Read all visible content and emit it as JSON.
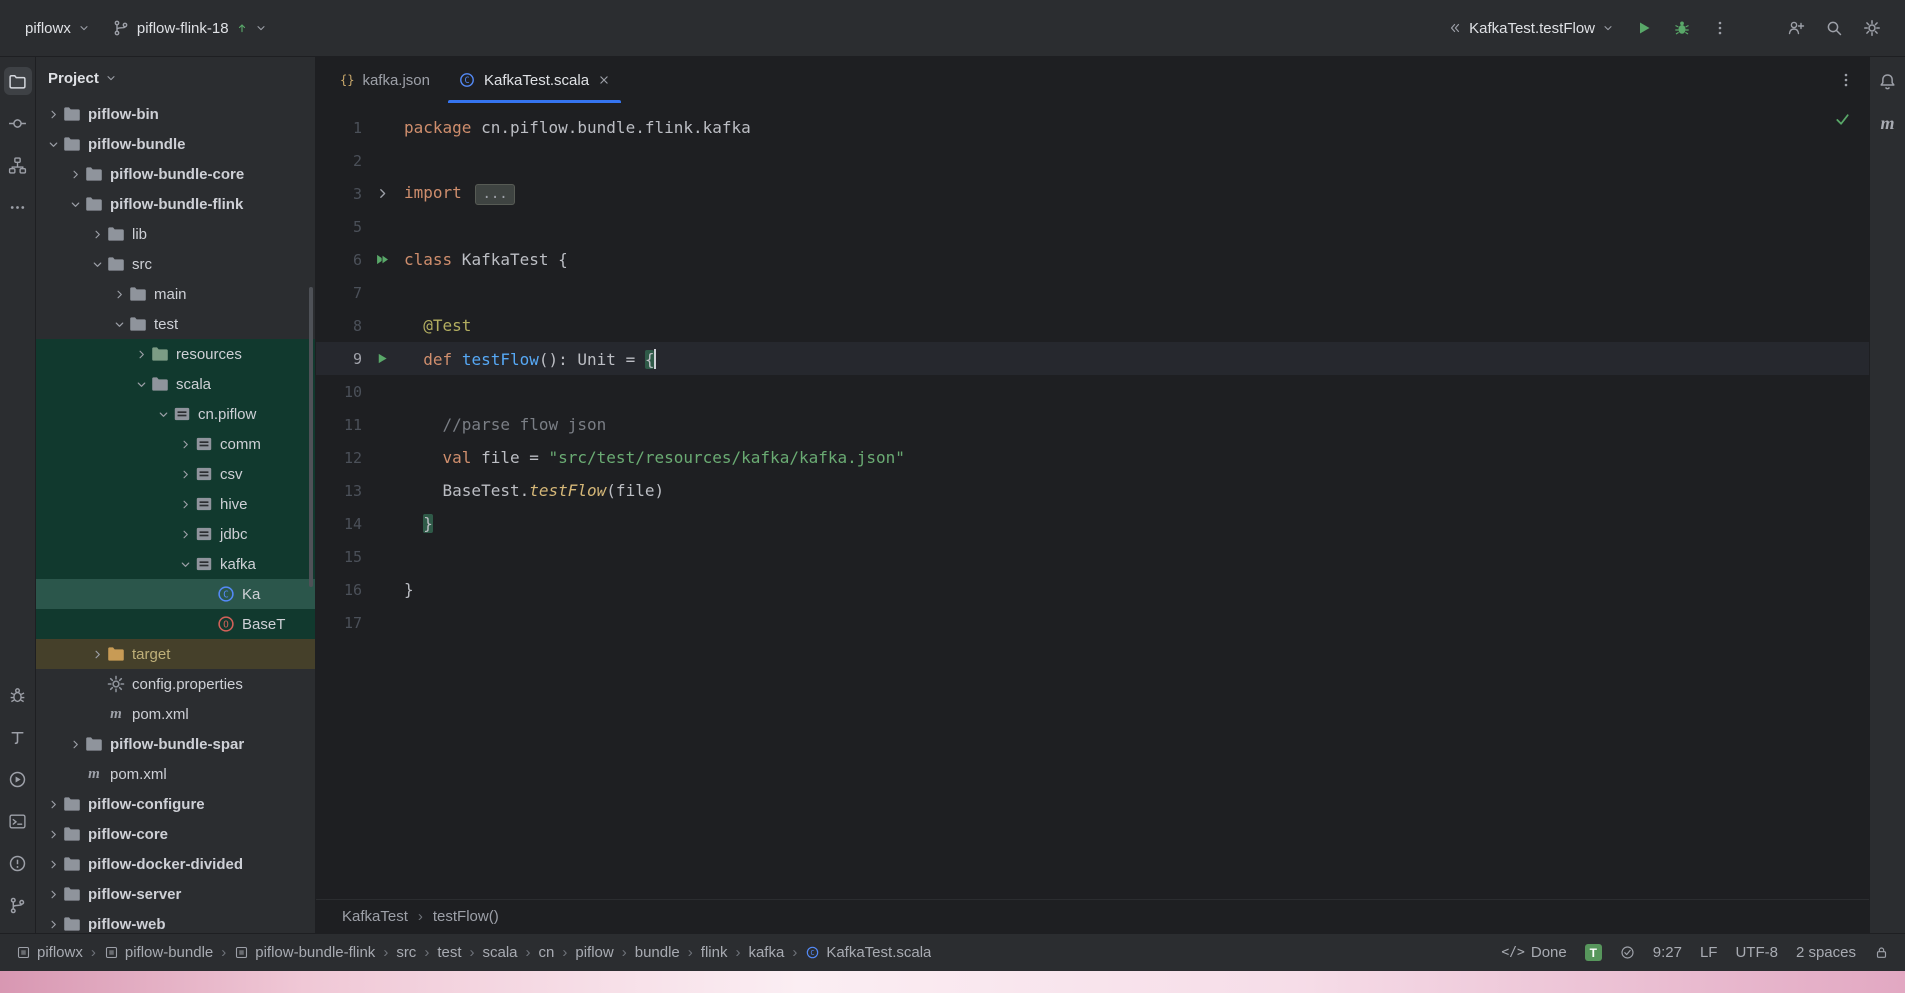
{
  "colors": {
    "panel_bg": "#2B2D30",
    "editor_bg": "#1E1F22",
    "accent_blue": "#3574F0",
    "run_green": "#59A869",
    "tree_test_bg": "#11392E",
    "tree_selected_bg": "#2B564B",
    "tree_excluded_bg": "#45402A",
    "keyword": "#CF8E6D",
    "string": "#6AAB73",
    "comment": "#7A7E85",
    "annotation": "#B3AE60",
    "function_decl": "#56A8F5",
    "method_call": "#D5B778"
  },
  "titlebar": {
    "project_name": "piflowx",
    "branch_name": "piflow-flink-18",
    "run_config": "KafkaTest.testFlow"
  },
  "left_stripe": {
    "top": [
      {
        "name": "project-icon"
      },
      {
        "name": "commit-icon"
      },
      {
        "name": "structure-icon"
      },
      {
        "name": "more-tools-icon"
      }
    ],
    "bottom": [
      {
        "name": "debug-icon"
      },
      {
        "name": "build-icon"
      },
      {
        "name": "run-icon"
      },
      {
        "name": "terminal-icon"
      },
      {
        "name": "problems-icon"
      },
      {
        "name": "version-control-icon"
      }
    ]
  },
  "right_stripe": [
    {
      "name": "notifications-bell-icon"
    },
    {
      "name": "maven-tool-icon"
    }
  ],
  "project_panel": {
    "title": "Project",
    "tree": [
      {
        "label": "piflow-bin",
        "level": 1,
        "icon": "folder",
        "chevron": "closed",
        "bold": true
      },
      {
        "label": "piflow-bundle",
        "level": 1,
        "icon": "folder",
        "chevron": "open",
        "bold": true
      },
      {
        "label": "piflow-bundle-core",
        "level": 2,
        "icon": "folder",
        "chevron": "closed",
        "bold": true
      },
      {
        "label": "piflow-bundle-flink",
        "level": 2,
        "icon": "folder",
        "chevron": "open",
        "bold": true
      },
      {
        "label": "lib",
        "level": 3,
        "icon": "folder",
        "chevron": "closed"
      },
      {
        "label": "src",
        "level": 3,
        "icon": "folder",
        "chevron": "open"
      },
      {
        "label": "main",
        "level": 4,
        "icon": "folder",
        "chevron": "closed"
      },
      {
        "label": "test",
        "level": 4,
        "icon": "folder",
        "chevron": "open"
      },
      {
        "label": "resources",
        "level": 5,
        "icon": "folder-resources",
        "chevron": "closed",
        "bg": "green"
      },
      {
        "label": "scala",
        "level": 5,
        "icon": "folder",
        "chevron": "open",
        "bg": "green"
      },
      {
        "label": "cn.piflow",
        "level": 6,
        "icon": "package",
        "chevron": "open",
        "bg": "green"
      },
      {
        "label": "comm",
        "level": 7,
        "icon": "package",
        "chevron": "closed",
        "bg": "green"
      },
      {
        "label": "csv",
        "level": 7,
        "icon": "package",
        "chevron": "closed",
        "bg": "green"
      },
      {
        "label": "hive",
        "level": 7,
        "icon": "package",
        "chevron": "closed",
        "bg": "green"
      },
      {
        "label": "jdbc",
        "level": 7,
        "icon": "package",
        "chevron": "closed",
        "bg": "green"
      },
      {
        "label": "kafka",
        "level": 7,
        "icon": "package",
        "chevron": "open",
        "bg": "green"
      },
      {
        "label": "Ka",
        "level": 8,
        "icon": "scala-class",
        "chevron": null,
        "bg": "sel"
      },
      {
        "label": "BaseT",
        "level": 8,
        "icon": "scala-object",
        "chevron": null,
        "bg": "green"
      },
      {
        "label": "target",
        "level": 3,
        "icon": "folder-excluded",
        "chevron": "closed",
        "bg": "olive"
      },
      {
        "label": "config.properties",
        "level": 3,
        "icon": "properties",
        "chevron": null
      },
      {
        "label": "pom.xml",
        "level": 3,
        "icon": "maven-file",
        "chevron": null
      },
      {
        "label": "piflow-bundle-spar",
        "level": 2,
        "icon": "folder",
        "chevron": "closed",
        "bold": true
      },
      {
        "label": "pom.xml",
        "level": 2,
        "icon": "maven-file",
        "chevron": null
      },
      {
        "label": "piflow-configure",
        "level": 1,
        "icon": "folder",
        "chevron": "closed",
        "bold": true
      },
      {
        "label": "piflow-core",
        "level": 1,
        "icon": "folder",
        "chevron": "closed",
        "bold": true
      },
      {
        "label": "piflow-docker-divided",
        "level": 1,
        "icon": "folder",
        "chevron": "closed",
        "bold": true
      },
      {
        "label": "piflow-server",
        "level": 1,
        "icon": "folder",
        "chevron": "closed",
        "bold": true
      },
      {
        "label": "piflow-web",
        "level": 1,
        "icon": "folder",
        "chevron": "closed",
        "bold": true
      }
    ]
  },
  "editor": {
    "tabs": [
      {
        "label": "kafka.json",
        "icon": "json-file",
        "active": false
      },
      {
        "label": "KafkaTest.scala",
        "icon": "scala-class",
        "active": true,
        "closable": true
      }
    ],
    "lines": [
      {
        "n": "1",
        "seg": [
          [
            "package",
            "kw"
          ],
          [
            " cn.piflow.bundle.flink.kafka",
            "pl"
          ]
        ]
      },
      {
        "n": "2",
        "seg": []
      },
      {
        "n": "3",
        "seg": [
          [
            "import",
            "kw"
          ],
          [
            " ",
            "pl"
          ]
        ],
        "fold": "...",
        "gutter": "fold"
      },
      {
        "n": "5",
        "seg": []
      },
      {
        "n": "6",
        "seg": [
          [
            "class",
            "kw"
          ],
          [
            " KafkaTest {",
            "pl"
          ]
        ],
        "gutter": "run2"
      },
      {
        "n": "7",
        "seg": []
      },
      {
        "n": "8",
        "seg": [
          [
            "  ",
            "pl"
          ],
          [
            "@Test",
            "ann"
          ]
        ]
      },
      {
        "n": "9",
        "seg": [
          [
            "  ",
            "pl"
          ],
          [
            "def",
            "kw"
          ],
          [
            " ",
            "pl"
          ],
          [
            "testFlow",
            "fn"
          ],
          [
            "(): Unit = ",
            "pl"
          ],
          [
            "{",
            "pl brace"
          ]
        ],
        "gutter": "run",
        "current": true,
        "caret": true
      },
      {
        "n": "10",
        "seg": []
      },
      {
        "n": "11",
        "seg": [
          [
            "    ",
            "pl"
          ],
          [
            "//parse flow json",
            "cmt"
          ]
        ]
      },
      {
        "n": "12",
        "seg": [
          [
            "    ",
            "pl"
          ],
          [
            "val",
            "kw"
          ],
          [
            " file = ",
            "pl"
          ],
          [
            "\"src/test/resources/kafka/kafka.json\"",
            "str"
          ]
        ]
      },
      {
        "n": "13",
        "seg": [
          [
            "    ",
            "pl"
          ],
          [
            "BaseTest.",
            "pl"
          ],
          [
            "testFlow",
            "call"
          ],
          [
            "(file)",
            "pl"
          ]
        ]
      },
      {
        "n": "14",
        "seg": [
          [
            "  ",
            "pl"
          ],
          [
            "}",
            "pl brace"
          ]
        ]
      },
      {
        "n": "15",
        "seg": []
      },
      {
        "n": "16",
        "seg": [
          [
            "}",
            "pl"
          ]
        ]
      },
      {
        "n": "17",
        "seg": []
      }
    ],
    "breadcrumbs": [
      "KafkaTest",
      "testFlow()"
    ]
  },
  "statusbar": {
    "path": [
      {
        "label": "piflowx",
        "icon": "module"
      },
      {
        "label": "piflow-bundle",
        "icon": "module"
      },
      {
        "label": "piflow-bundle-flink",
        "icon": "module"
      },
      {
        "label": "src"
      },
      {
        "label": "test"
      },
      {
        "label": "scala"
      },
      {
        "label": "cn"
      },
      {
        "label": "piflow"
      },
      {
        "label": "bundle"
      },
      {
        "label": "flink"
      },
      {
        "label": "kafka"
      },
      {
        "label": "KafkaTest.scala",
        "icon": "scala-class"
      }
    ],
    "right": [
      {
        "name": "build-done-indicator",
        "icon": "code-brackets",
        "label": "Done"
      },
      {
        "name": "translate-badge",
        "icon": "t-badge"
      },
      {
        "name": "check-indicator",
        "icon": "check-circle-icon"
      },
      {
        "name": "caret-position",
        "label": "9:27"
      },
      {
        "name": "line-separator",
        "label": "LF"
      },
      {
        "name": "file-encoding",
        "label": "UTF-8"
      },
      {
        "name": "indent-style",
        "label": "2 spaces"
      },
      {
        "name": "readonly-toggle",
        "icon": "lock-icon"
      }
    ]
  }
}
